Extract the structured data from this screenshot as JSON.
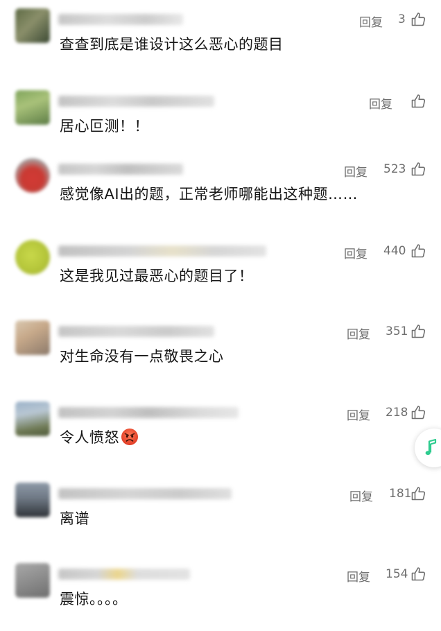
{
  "comments": [
    {
      "text": "查查到底是谁设计这么恶心的题目",
      "reply_label": "回复",
      "likes": "3"
    },
    {
      "text": "居心叵测！！",
      "reply_label": "回复",
      "likes": ""
    },
    {
      "text": "感觉像AI出的题，正常老师哪能出这种题……",
      "reply_label": "回复",
      "likes": "523"
    },
    {
      "text": "这是我见过最恶心的题目了！",
      "reply_label": "回复",
      "likes": "440"
    },
    {
      "text": "对生命没有一点敬畏之心",
      "reply_label": "回复",
      "likes": "351"
    },
    {
      "text": "令人愤怒",
      "reply_label": "回复",
      "likes": "218"
    },
    {
      "text": "离谱",
      "reply_label": "回复",
      "likes": "181"
    },
    {
      "text": "震惊。。。。",
      "reply_label": "回复",
      "likes": "154"
    }
  ],
  "icons": {
    "like": "thumbs-up-icon",
    "music": "music-note-icon",
    "emoji": "angry-face-emoji"
  },
  "colors": {
    "text": "#161616",
    "meta": "#6f6f6f",
    "music_accent": "#2ecc8f",
    "emoji_red": "#e8472f"
  }
}
